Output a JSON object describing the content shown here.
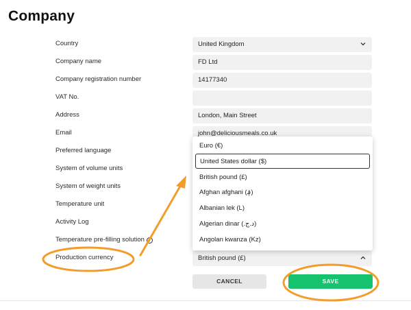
{
  "page": {
    "title": "Company"
  },
  "form": {
    "country": {
      "label": "Country",
      "value": "United Kingdom"
    },
    "company_name": {
      "label": "Company name",
      "value": "FD Ltd"
    },
    "registration_number": {
      "label": "Company registration number",
      "value": "14177340"
    },
    "vat": {
      "label": "VAT No.",
      "value": ""
    },
    "address": {
      "label": "Address",
      "value": "London, Main Street"
    },
    "email": {
      "label": "Email",
      "value": "john@deliciousmeals.co.uk"
    },
    "preferred_language": {
      "label": "Preferred language"
    },
    "volume_units": {
      "label": "System of volume units"
    },
    "weight_units": {
      "label": "System of weight units"
    },
    "temperature_unit": {
      "label": "Temperature unit"
    },
    "activity_log": {
      "label": "Activity Log"
    },
    "temperature_prefilling": {
      "label": "Temperature pre-filling solution",
      "info_icon": "info-icon"
    },
    "production_currency": {
      "label": "Production currency",
      "value": "British pound (£)"
    }
  },
  "currency_dropdown": {
    "options": [
      "Euro (€)",
      "United States dollar ($)",
      "British pound (£)",
      "Afghan afghani (؋)",
      "Albanian lek (L)",
      "Algerian dinar (.د.ج)",
      "Angolan kwanza (Kz)"
    ],
    "highlighted_index": 1
  },
  "buttons": {
    "cancel": "CANCEL",
    "save": "SAVE"
  },
  "colors": {
    "accent_green": "#16c26e",
    "annotation_orange": "#f39c2a",
    "field_bg": "#f1f1f2"
  }
}
